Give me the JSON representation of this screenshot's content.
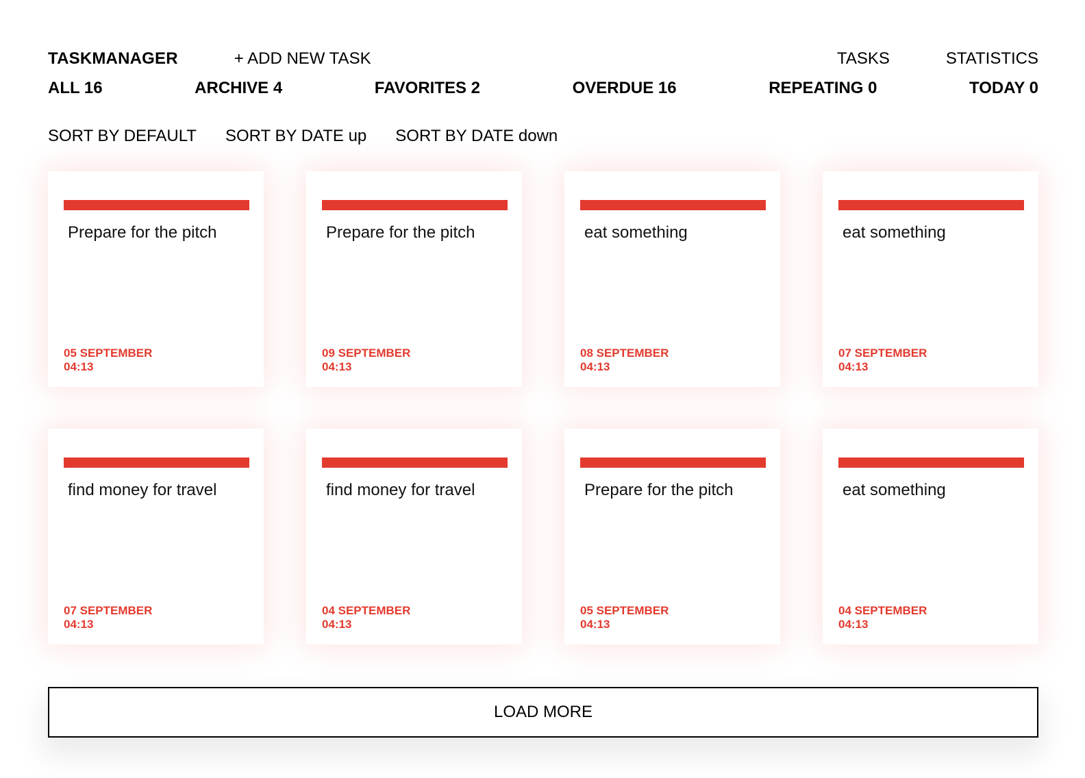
{
  "header": {
    "logo": "TASKMANAGER",
    "add_task": "+ ADD NEW TASK",
    "nav": [
      {
        "label": "TASKS"
      },
      {
        "label": "STATISTICS"
      }
    ]
  },
  "filters": [
    {
      "label": "ALL 16"
    },
    {
      "label": "ARCHIVE 4"
    },
    {
      "label": "FAVORITES 2"
    },
    {
      "label": "OVERDUE 16"
    },
    {
      "label": "REPEATING 0"
    },
    {
      "label": "TODAY 0"
    }
  ],
  "sort": [
    {
      "label": "SORT BY DEFAULT"
    },
    {
      "label": "SORT BY DATE up"
    },
    {
      "label": "SORT BY DATE down"
    }
  ],
  "accent_color": "#e33a2e",
  "cards": [
    {
      "title": "Prepare for the pitch",
      "date": "05 SEPTEMBER",
      "time": "04:13"
    },
    {
      "title": "Prepare for the pitch",
      "date": "09 SEPTEMBER",
      "time": "04:13"
    },
    {
      "title": "eat something",
      "date": "08 SEPTEMBER",
      "time": "04:13"
    },
    {
      "title": "eat something",
      "date": "07 SEPTEMBER",
      "time": "04:13"
    },
    {
      "title": "find money for travel",
      "date": "07 SEPTEMBER",
      "time": "04:13"
    },
    {
      "title": "find money for travel",
      "date": "04 SEPTEMBER",
      "time": "04:13"
    },
    {
      "title": "Prepare for the pitch",
      "date": "05 SEPTEMBER",
      "time": "04:13"
    },
    {
      "title": "eat something",
      "date": "04 SEPTEMBER",
      "time": "04:13"
    }
  ],
  "load_more": "LOAD MORE"
}
